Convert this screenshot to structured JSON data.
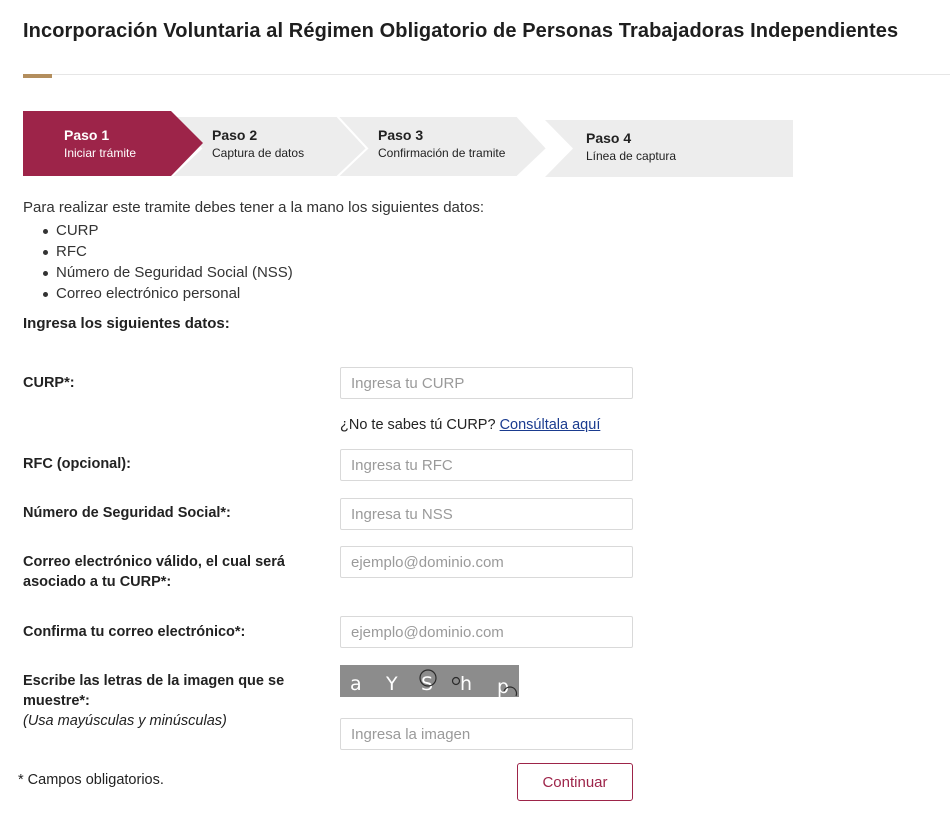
{
  "page": {
    "title": "Incorporación Voluntaria al Régimen Obligatorio de Personas Trabajadoras Independientes"
  },
  "steps": [
    {
      "title": "Paso 1",
      "subtitle": "Iniciar trámite",
      "active": true
    },
    {
      "title": "Paso 2",
      "subtitle": "Captura de datos",
      "active": false
    },
    {
      "title": "Paso 3",
      "subtitle": "Confirmación de tramite",
      "active": false
    },
    {
      "title": "Paso 4",
      "subtitle": "Línea de captura",
      "active": false
    }
  ],
  "intro": {
    "text": "Para realizar este tramite debes tener a la mano los siguientes datos:",
    "items": [
      "CURP",
      "RFC",
      "Número de Seguridad Social (NSS)",
      "Correo electrónico personal"
    ]
  },
  "form": {
    "heading": "Ingresa los siguientes datos:",
    "curp": {
      "label": "CURP*:",
      "placeholder": "Ingresa tu CURP",
      "value": ""
    },
    "curp_help": {
      "text": "¿No te sabes tú CURP?",
      "link": "Consúltala aquí"
    },
    "rfc": {
      "label": "RFC (opcional):",
      "placeholder": "Ingresa tu RFC",
      "value": ""
    },
    "nss": {
      "label": "Número de Seguridad Social*:",
      "placeholder": "Ingresa tu NSS",
      "value": ""
    },
    "email": {
      "label": "Correo electrónico válido, el cual será asociado a tu CURP*:",
      "placeholder": "ejemplo@dominio.com",
      "value": ""
    },
    "email_confirm": {
      "label": "Confirma tu correo electrónico*:",
      "placeholder": "ejemplo@dominio.com",
      "value": ""
    },
    "captcha": {
      "label": "Escribe las letras de la imagen que se muestre*:",
      "hint": "(Usa mayúsculas y minúsculas)",
      "letters": [
        "a",
        "Y",
        "S",
        "h",
        "p"
      ],
      "placeholder": "Ingresa la imagen",
      "value": ""
    },
    "required_note": "* Campos obligatorios.",
    "submit_label": "Continuar"
  },
  "colors": {
    "primary": "#9d2449",
    "accent": "#b38e5d",
    "step_inactive": "#ededed",
    "link": "#1a3b8f"
  }
}
